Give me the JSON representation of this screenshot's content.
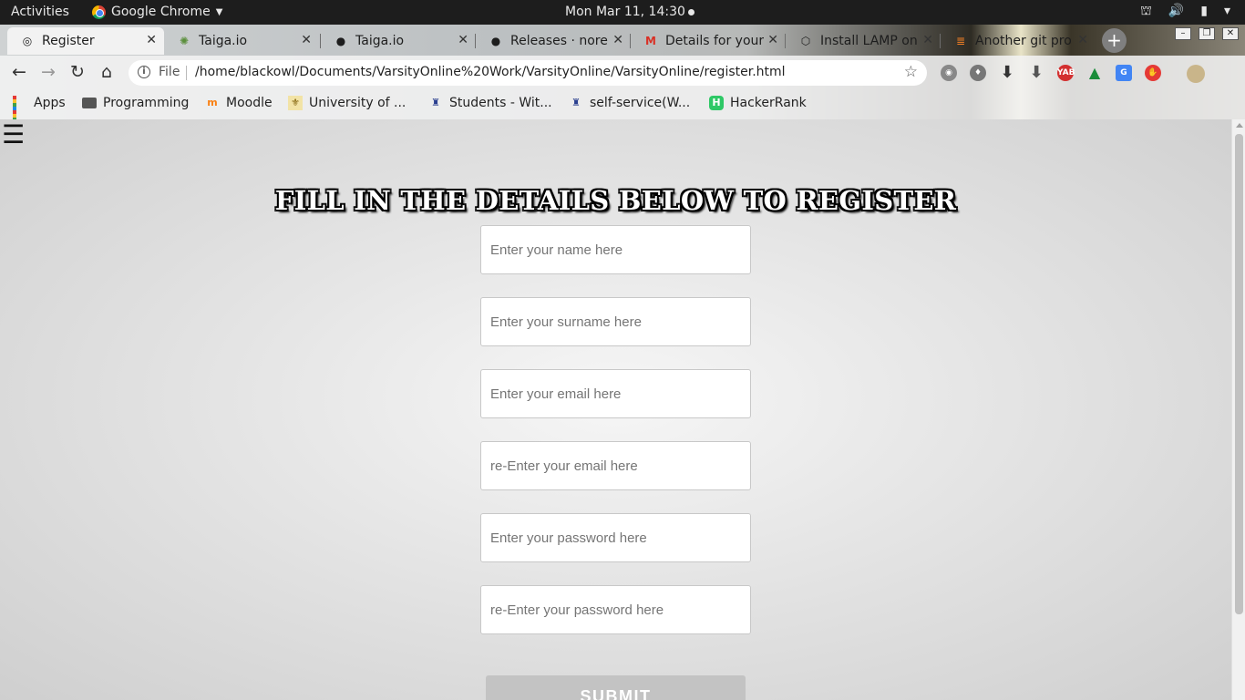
{
  "system_bar": {
    "activities": "Activities",
    "app_name": "Google Chrome",
    "clock": "Mon Mar 11, 14:30"
  },
  "tabs": [
    {
      "title": "Register",
      "favicon": "page-icon"
    },
    {
      "title": "Taiga.io",
      "favicon": "taiga-icon"
    },
    {
      "title": "Taiga.io",
      "favicon": "github-icon"
    },
    {
      "title": "Releases · norel",
      "favicon": "github-icon"
    },
    {
      "title": "Details for your",
      "favicon": "gmail-icon"
    },
    {
      "title": "Install LAMP on",
      "favicon": "globe-icon"
    },
    {
      "title": "Another git pro",
      "favicon": "stackoverflow-icon"
    }
  ],
  "address_bar": {
    "scheme_label": "File",
    "url": "/home/blackowl/Documents/VarsityOnline%20Work/VarsityOnline/VarsityOnline/register.html"
  },
  "bookmarks": [
    {
      "label": "Apps",
      "icon": "apps-grid-icon"
    },
    {
      "label": "Programming",
      "icon": "folder-icon"
    },
    {
      "label": "Moodle",
      "icon": "moodle-icon"
    },
    {
      "label": "University of ...",
      "icon": "university-icon"
    },
    {
      "label": "Students - Wit...",
      "icon": "wits-icon"
    },
    {
      "label": "self-service(W...",
      "icon": "wits-icon"
    },
    {
      "label": "HackerRank",
      "icon": "hackerrank-icon"
    }
  ],
  "page": {
    "menu_glyph": "☰",
    "heading": "FILL IN THE DETAILS BELOW TO REGISTER",
    "fields": [
      {
        "placeholder": "Enter your name here",
        "value": ""
      },
      {
        "placeholder": "Enter your surname here",
        "value": ""
      },
      {
        "placeholder": "Enter your email here",
        "value": ""
      },
      {
        "placeholder": "re-Enter your email here",
        "value": ""
      },
      {
        "placeholder": "Enter your password here",
        "value": ""
      },
      {
        "placeholder": "re-Enter your password here",
        "value": ""
      }
    ],
    "submit_label": "SUBMIT"
  },
  "colors": {
    "page_bg_center": "#f6f6f6",
    "page_bg_edge": "#cfcfcf",
    "submit_bg": "#c3c3c3"
  }
}
